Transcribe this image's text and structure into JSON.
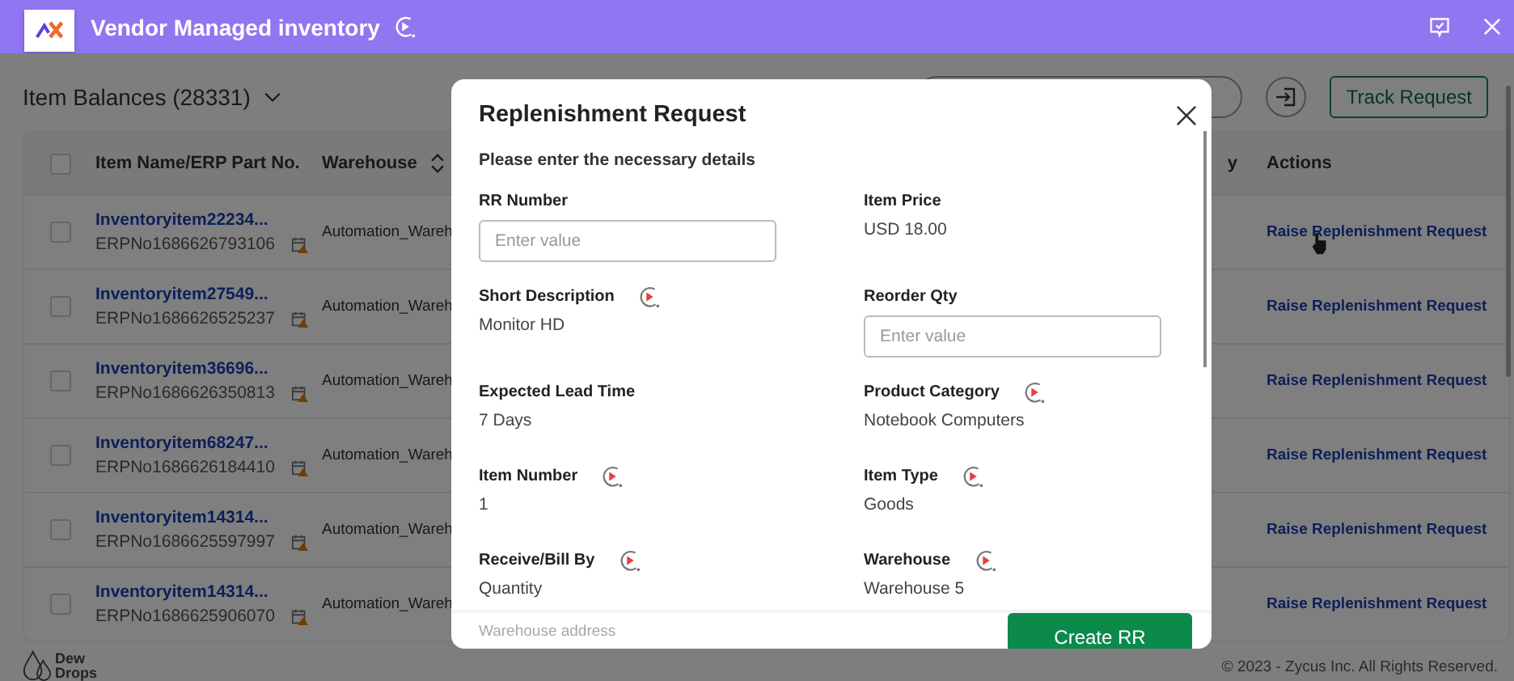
{
  "app": {
    "title": "Vendor Managed inventory"
  },
  "page": {
    "title": "Item Balances (28331)",
    "track_button": "Track Request"
  },
  "table": {
    "all_checked": false,
    "columns": [
      "Item Name/ERP Part No.",
      "Warehouse",
      "y",
      "Actions"
    ],
    "rows": [
      {
        "checked": false,
        "name": "Inventoryitem22234...",
        "erp": "ERPNo1686626793106",
        "warehouse": "Automation_Wareh",
        "action": "Raise Replenishment Request"
      },
      {
        "checked": false,
        "name": "Inventoryitem27549...",
        "erp": "ERPNo1686626525237",
        "warehouse": "Automation_Wareh",
        "action": "Raise Replenishment Request"
      },
      {
        "checked": false,
        "name": "Inventoryitem36696...",
        "erp": "ERPNo1686626350813",
        "warehouse": "Automation_Wareh",
        "action": "Raise Replenishment Request"
      },
      {
        "checked": false,
        "name": "Inventoryitem68247...",
        "erp": "ERPNo1686626184410",
        "warehouse": "Automation_Wareh",
        "action": "Raise Replenishment Request"
      },
      {
        "checked": false,
        "name": "Inventoryitem14314...",
        "erp": "ERPNo1686625597997",
        "warehouse": "Automation_Wareh",
        "action": "Raise Replenishment Request"
      },
      {
        "checked": false,
        "name": "Inventoryitem14314...",
        "erp": "ERPNo1686625906070",
        "warehouse": "Automation_Wareh",
        "action": "Raise Replenishment Request"
      }
    ]
  },
  "footer": {
    "brand": [
      "Dew",
      "Drops"
    ],
    "copyright": "© 2023 - Zycus Inc. All Rights Reserved."
  },
  "modal": {
    "title": "Replenishment Request",
    "intro": "Please enter the necessary details",
    "fields": [
      {
        "kind": "input",
        "label": "RR Number",
        "placeholder": "Enter value",
        "help": false
      },
      {
        "kind": "text",
        "label": "Item Price",
        "value": "USD 18.00",
        "help": false
      },
      {
        "kind": "text",
        "label": "Short Description",
        "value": "Monitor HD",
        "help": true
      },
      {
        "kind": "input",
        "label": "Reorder Qty",
        "placeholder": "Enter value",
        "help": false
      },
      {
        "kind": "text",
        "label": "Expected Lead Time",
        "value": "7 Days",
        "help": false
      },
      {
        "kind": "text",
        "label": "Product Category",
        "value": "Notebook Computers",
        "help": true
      },
      {
        "kind": "text",
        "label": "Item Number",
        "value": "1",
        "help": true
      },
      {
        "kind": "text",
        "label": "Item Type",
        "value": "Goods",
        "help": true
      },
      {
        "kind": "text",
        "label": "Receive/Bill By",
        "value": "Quantity",
        "help": true
      },
      {
        "kind": "text",
        "label": "Warehouse",
        "value": "Warehouse 5",
        "help": true
      }
    ],
    "faded_label": "Warehouse address",
    "submit": "Create RR"
  }
}
